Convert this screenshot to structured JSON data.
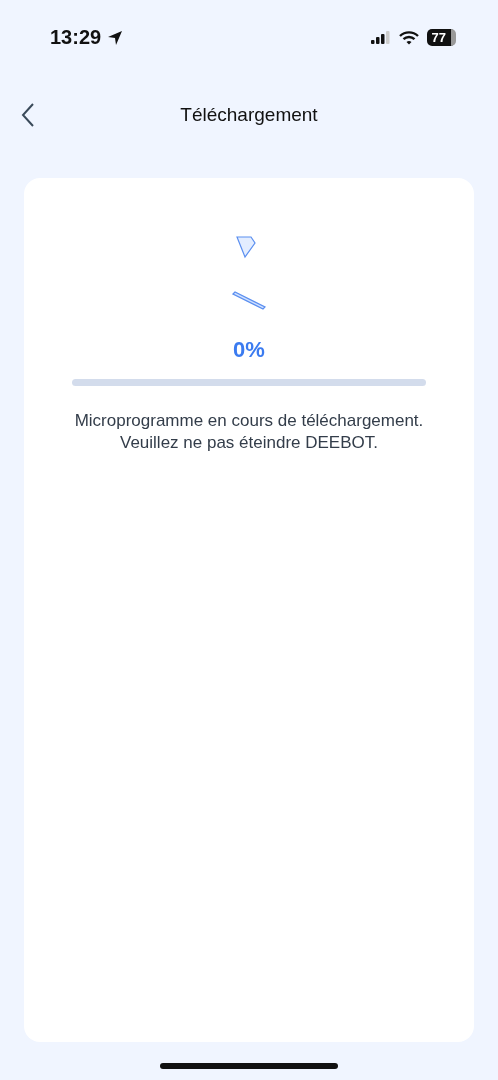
{
  "status_bar": {
    "time": "13:29",
    "battery": "77"
  },
  "nav": {
    "title": "Téléchargement"
  },
  "download": {
    "percent": "0%",
    "level": 0,
    "message": "Microprogramme en cours de téléchargement.\nVeuillez ne pas éteindre DEEBOT."
  }
}
